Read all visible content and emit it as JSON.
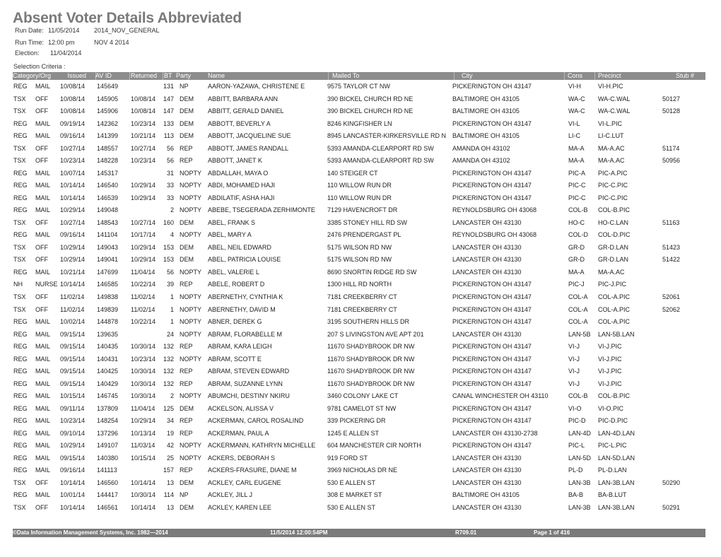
{
  "report": {
    "title": "Absent Voter Details Abbreviated",
    "run_date_label": "Run Date:",
    "run_date": "11/05/2014",
    "election_code": "2014_NOV_GENERAL",
    "run_time_label": "Run Time:",
    "run_time": "12:00 pm",
    "election_name": "NOV 4 2014",
    "election_label": "Election:",
    "election_date": "11/04/2014",
    "selection_criteria": "Selection Criteria :"
  },
  "table": {
    "headers": [
      "Category/Org",
      "Issued",
      "AV ID",
      "Returned",
      "BT",
      "Party",
      "Name",
      "Mailed To",
      "City",
      "Cons",
      "Precinct",
      "Stub #"
    ],
    "rows": [
      [
        "REG",
        "MAIL",
        "10/08/14",
        "145649",
        "",
        "131",
        "NP",
        "AARON-YAZAWA, CHRISTENE E",
        "9575 TAYLOR CT NW",
        "PICKERINGTON OH 43147",
        "VI-H",
        "VI-H.PIC",
        ""
      ],
      [
        "TSX",
        "OFF",
        "10/08/14",
        "145905",
        "10/08/14",
        "147",
        "DEM",
        "ABBITT, BARBARA ANN",
        "390 BICKEL CHURCH RD NE",
        "BALTIMORE OH 43105",
        "WA-C",
        "WA-C.WAL",
        "50127"
      ],
      [
        "TSX",
        "OFF",
        "10/08/14",
        "145906",
        "10/08/14",
        "147",
        "DEM",
        "ABBITT, GERALD DANIEL",
        "390 BICKEL CHURCH RD NE",
        "BALTIMORE OH 43105",
        "WA-C",
        "WA-C.WAL",
        "50128"
      ],
      [
        "REG",
        "MAIL",
        "09/19/14",
        "142362",
        "10/23/14",
        "133",
        "DEM",
        "ABBOTT, BEVERLY A",
        "8246 KINGFISHER LN",
        "PICKERINGTON OH 43147",
        "VI-L",
        "VI-L.PIC",
        ""
      ],
      [
        "REG",
        "MAIL",
        "09/16/14",
        "141399",
        "10/21/14",
        "113",
        "DEM",
        "ABBOTT, JACQUELINE SUE",
        "8945 LANCASTER-KIRKERSVILLE RD N",
        "BALTIMORE OH 43105",
        "LI-C",
        "LI-C.LUT",
        ""
      ],
      [
        "TSX",
        "OFF",
        "10/27/14",
        "148557",
        "10/27/14",
        "56",
        "REP",
        "ABBOTT, JAMES RANDALL",
        "5393 AMANDA-CLEARPORT RD SW",
        "AMANDA OH 43102",
        "MA-A",
        "MA-A.AC",
        "51174"
      ],
      [
        "TSX",
        "OFF",
        "10/23/14",
        "148228",
        "10/23/14",
        "56",
        "REP",
        "ABBOTT, JANET K",
        "5393 AMANDA-CLEARPORT RD SW",
        "AMANDA OH 43102",
        "MA-A",
        "MA-A.AC",
        "50956"
      ],
      [
        "REG",
        "MAIL",
        "10/07/14",
        "145317",
        "",
        "31",
        "NOPTY",
        "ABDALLAH, MAYA O",
        "140 STEIGER CT",
        "PICKERINGTON OH 43147",
        "PIC-A",
        "PIC-A.PIC",
        ""
      ],
      [
        "REG",
        "MAIL",
        "10/14/14",
        "146540",
        "10/29/14",
        "33",
        "NOPTY",
        "ABDI, MOHAMED HAJI",
        "110 WILLOW RUN DR",
        "PICKERINGTON OH 43147",
        "PIC-C",
        "PIC-C.PIC",
        ""
      ],
      [
        "REG",
        "MAIL",
        "10/14/14",
        "146539",
        "10/29/14",
        "33",
        "NOPTY",
        "ABDILATIF, ASHA HAJI",
        "110 WILLOW RUN DR",
        "PICKERINGTON OH 43147",
        "PIC-C",
        "PIC-C.PIC",
        ""
      ],
      [
        "REG",
        "MAIL",
        "10/29/14",
        "149048",
        "",
        "2",
        "NOPTY",
        "ABEBE, TSEGERADA ZERHIMONTE",
        "7129 HAVENCROFT DR",
        "REYNOLDSBURG OH 43068",
        "COL-B",
        "COL-B.PIC",
        ""
      ],
      [
        "TSX",
        "OFF",
        "10/27/14",
        "148543",
        "10/27/14",
        "160",
        "DEM",
        "ABEL, FRANK S",
        "3385 STONEY HILL RD SW",
        "LANCASTER OH 43130",
        "HO-C",
        "HO-C.LAN",
        "51163"
      ],
      [
        "REG",
        "MAIL",
        "09/16/14",
        "141104",
        "10/17/14",
        "4",
        "NOPTY",
        "ABEL, MARY A",
        "2476 PRENDERGAST PL",
        "REYNOLDSBURG OH 43068",
        "COL-D",
        "COL-D.PIC",
        ""
      ],
      [
        "TSX",
        "OFF",
        "10/29/14",
        "149043",
        "10/29/14",
        "153",
        "DEM",
        "ABEL, NEIL EDWARD",
        "5175 WILSON RD NW",
        "LANCASTER OH 43130",
        "GR-D",
        "GR-D.LAN",
        "51423"
      ],
      [
        "TSX",
        "OFF",
        "10/29/14",
        "149041",
        "10/29/14",
        "153",
        "DEM",
        "ABEL, PATRICIA LOUISE",
        "5175 WILSON RD NW",
        "LANCASTER OH 43130",
        "GR-D",
        "GR-D.LAN",
        "51422"
      ],
      [
        "REG",
        "MAIL",
        "10/21/14",
        "147699",
        "11/04/14",
        "56",
        "NOPTY",
        "ABEL, VALERIE L",
        "8690 SNORTIN RIDGE RD SW",
        "LANCASTER OH 43130",
        "MA-A",
        "MA-A.AC",
        ""
      ],
      [
        "NH",
        "NURSE",
        "10/14/14",
        "146585",
        "10/22/14",
        "39",
        "REP",
        "ABELE, ROBERT D",
        "1300 HILL RD NORTH",
        "PICKERINGTON OH 43147",
        "PIC-J",
        "PIC-J.PIC",
        ""
      ],
      [
        "TSX",
        "OFF",
        "11/02/14",
        "149838",
        "11/02/14",
        "1",
        "NOPTY",
        "ABERNETHY, CYNTHIA K",
        "7181 CREEKBERRY CT",
        "PICKERINGTON OH 43147",
        "COL-A",
        "COL-A.PIC",
        "52061"
      ],
      [
        "TSX",
        "OFF",
        "11/02/14",
        "149839",
        "11/02/14",
        "1",
        "NOPTY",
        "ABERNETHY, DAVID M",
        "7181 CREEKBERRY CT",
        "PICKERINGTON OH 43147",
        "COL-A",
        "COL-A.PIC",
        "52062"
      ],
      [
        "REG",
        "MAIL",
        "10/02/14",
        "144878",
        "10/22/14",
        "1",
        "NOPTY",
        "ABNER, DEREK G",
        "3195 SOUTHERN HILLS DR",
        "PICKERINGTON OH 43147",
        "COL-A",
        "COL-A.PIC",
        ""
      ],
      [
        "REG",
        "MAIL",
        "09/15/14",
        "139635",
        "",
        "24",
        "NOPTY",
        "ABRAM, FLORABELLE M",
        "207 S LIVINGSTON AVE APT 201",
        "LANCASTER OH 43130",
        "LAN-5B",
        "LAN-5B.LAN",
        ""
      ],
      [
        "REG",
        "MAIL",
        "09/15/14",
        "140435",
        "10/30/14",
        "132",
        "REP",
        "ABRAM, KARA LEIGH",
        "11670 SHADYBROOK DR NW",
        "PICKERINGTON OH 43147",
        "VI-J",
        "VI-J.PIC",
        ""
      ],
      [
        "REG",
        "MAIL",
        "09/15/14",
        "140431",
        "10/23/14",
        "132",
        "NOPTY",
        "ABRAM, SCOTT E",
        "11670 SHADYBROOK DR NW",
        "PICKERINGTON OH 43147",
        "VI-J",
        "VI-J.PIC",
        ""
      ],
      [
        "REG",
        "MAIL",
        "09/15/14",
        "140425",
        "10/30/14",
        "132",
        "REP",
        "ABRAM, STEVEN EDWARD",
        "11670 SHADYBROOK DR NW",
        "PICKERINGTON OH 43147",
        "VI-J",
        "VI-J.PIC",
        ""
      ],
      [
        "REG",
        "MAIL",
        "09/15/14",
        "140429",
        "10/30/14",
        "132",
        "REP",
        "ABRAM, SUZANNE LYNN",
        "11670 SHADYBROOK DR NW",
        "PICKERINGTON OH 43147",
        "VI-J",
        "VI-J.PIC",
        ""
      ],
      [
        "REG",
        "MAIL",
        "10/15/14",
        "146745",
        "10/30/14",
        "2",
        "NOPTY",
        "ABUMCHI, DESTINY NKIRU",
        "3460 COLONY LAKE CT",
        "CANAL WINCHESTER OH 43110",
        "COL-B",
        "COL-B.PIC",
        ""
      ],
      [
        "REG",
        "MAIL",
        "09/11/14",
        "137809",
        "11/04/14",
        "125",
        "DEM",
        "ACKELSON, ALISSA V",
        "9781 CAMELOT ST NW",
        "PICKERINGTON OH 43147",
        "VI-O",
        "VI-O.PIC",
        ""
      ],
      [
        "REG",
        "MAIL",
        "10/23/14",
        "148254",
        "10/29/14",
        "34",
        "REP",
        "ACKERMAN, CAROL ROSALIND",
        "339 PICKERING DR",
        "PICKERINGTON OH 43147",
        "PIC-D",
        "PIC-D.PIC",
        ""
      ],
      [
        "REG",
        "MAIL",
        "09/10/14",
        "137296",
        "10/13/14",
        "19",
        "REP",
        "ACKERMAN, PAUL A",
        "1245 E ALLEN ST",
        "LANCASTER OH 43130-2738",
        "LAN-4D",
        "LAN-4D.LAN",
        ""
      ],
      [
        "REG",
        "MAIL",
        "10/29/14",
        "149107",
        "11/03/14",
        "42",
        "NOPTY",
        "ACKERMANN, KATHRYN MICHELLE",
        "604 MANCHESTER CIR NORTH",
        "PICKERINGTON OH 43147",
        "PIC-L",
        "PIC-L.PIC",
        ""
      ],
      [
        "REG",
        "MAIL",
        "09/15/14",
        "140380",
        "10/15/14",
        "25",
        "NOPTY",
        "ACKERS, DEBORAH S",
        "919 FORD ST",
        "LANCASTER OH 43130",
        "LAN-5D",
        "LAN-5D.LAN",
        ""
      ],
      [
        "REG",
        "MAIL",
        "09/16/14",
        "141113",
        "",
        "157",
        "REP",
        "ACKERS-FRASURE, DIANE M",
        "3969 NICHOLAS DR NE",
        "LANCASTER OH 43130",
        "PL-D",
        "PL-D.LAN",
        ""
      ],
      [
        "TSX",
        "OFF",
        "10/14/14",
        "146560",
        "10/14/14",
        "13",
        "DEM",
        "ACKLEY, CARL EUGENE",
        "530 E ALLEN ST",
        "LANCASTER OH 43130",
        "LAN-3B",
        "LAN-3B.LAN",
        "50290"
      ],
      [
        "REG",
        "MAIL",
        "10/01/14",
        "144417",
        "10/30/14",
        "114",
        "NP",
        "ACKLEY, JILL J",
        "308 E MARKET ST",
        "BALTIMORE OH 43105",
        "BA-B",
        "BA-B.LUT",
        ""
      ],
      [
        "TSX",
        "OFF",
        "10/14/14",
        "146561",
        "10/14/14",
        "13",
        "DEM",
        "ACKLEY, KAREN LEE",
        "530 E ALLEN ST",
        "LANCASTER OH 43130",
        "LAN-3B",
        "LAN-3B.LAN",
        "50291"
      ]
    ]
  },
  "footer": {
    "copyright": "©Data Information Management Systems, Inc. 1982—2014",
    "timestamp": "11/5/2014  12:00:54PM",
    "report_id": "R709.01",
    "page": "Page 1 of 416"
  },
  "colors": {
    "title": "#7a7a7a",
    "header_bar": "#8c8c8c",
    "footer_bar": "#7b7b7b"
  }
}
